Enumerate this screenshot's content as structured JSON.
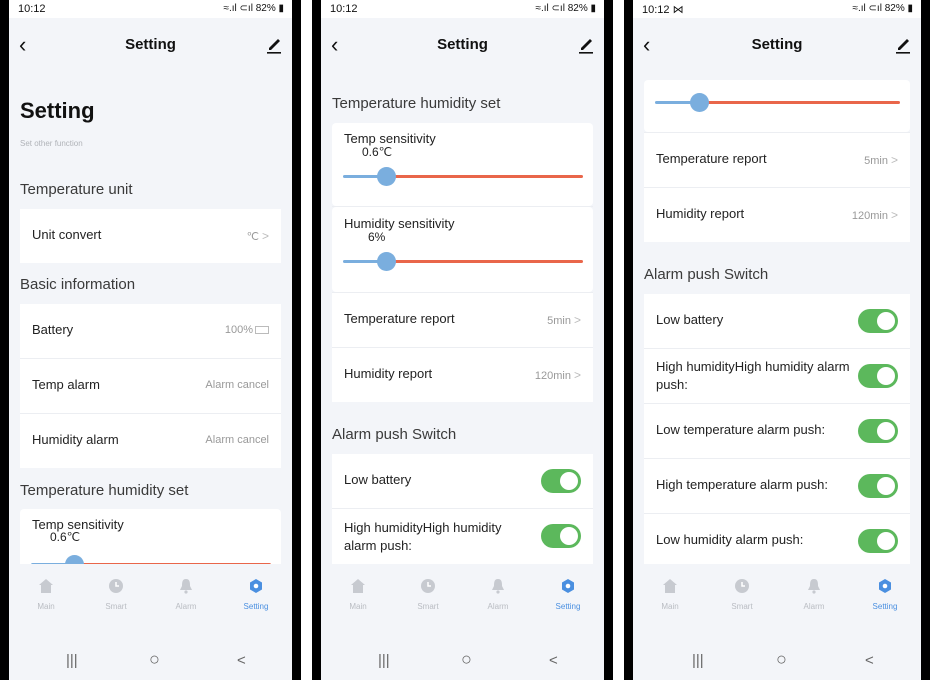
{
  "status": {
    "time": "10:12",
    "time3": "10:12 ⋈",
    "battery": "82%"
  },
  "nav": {
    "title": "Setting"
  },
  "page": {
    "heading": "Setting",
    "subtitle": "Set other function"
  },
  "temperature_unit": {
    "section": "Temperature unit",
    "unit_convert": {
      "label": "Unit convert",
      "value": "℃"
    }
  },
  "basic_info": {
    "section": "Basic information",
    "battery": {
      "label": "Battery",
      "value": "100%"
    },
    "temp_alarm": {
      "label": "Temp alarm",
      "value": "Alarm cancel"
    },
    "humidity_alarm": {
      "label": "Humidity alarm",
      "value": "Alarm cancel"
    }
  },
  "th_set": {
    "section": "Temperature humidity set",
    "temp_sensitivity": {
      "label": "Temp sensitivity",
      "value": "0.6℃",
      "level": 0.18
    },
    "humidity_sensitivity": {
      "label": "Humidity sensitivity",
      "value": "6%",
      "level": 0.18
    },
    "temperature_report": {
      "label": "Temperature report",
      "value": "5min"
    },
    "humidity_report": {
      "label": "Humidity report",
      "value": "120min"
    }
  },
  "alarm_push": {
    "section": "Alarm push Switch",
    "low_battery": {
      "label": "Low battery",
      "on": true
    },
    "high_humidity": {
      "label": "High humidityHigh humidity alarm push:",
      "on": true
    },
    "low_temp": {
      "label": "Low temperature alarm push:",
      "on": true
    },
    "high_temp": {
      "label": "High temperature alarm push:",
      "on": true
    },
    "low_humidity": {
      "label": "Low humidity alarm push:",
      "on": true
    }
  },
  "tabs": [
    {
      "label": "Main",
      "icon": "home-icon"
    },
    {
      "label": "Smart",
      "icon": "clock-icon"
    },
    {
      "label": "Alarm",
      "icon": "bell-icon"
    },
    {
      "label": "Setting",
      "icon": "settings-hex-icon",
      "active": true
    }
  ],
  "system_nav": {
    "recent": "|||",
    "home": "○",
    "back": "<"
  },
  "colors": {
    "accent": "#4a8fe0",
    "toggle_on": "#5cb85c",
    "slider_low": "#7aaede",
    "slider_high": "#e9664a"
  }
}
